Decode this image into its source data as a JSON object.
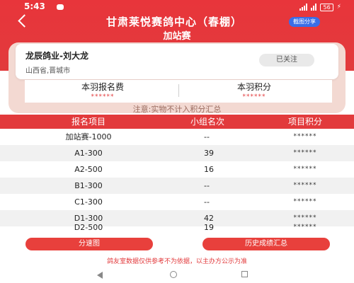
{
  "status_bar": {
    "time": "5:43",
    "battery": "56"
  },
  "header": {
    "title": "甘肃莱悦赛鸽中心（春棚）",
    "subtitle": "加站赛",
    "share_label": "截图分享"
  },
  "owner": {
    "name": "龙辰鸽业-刘大龙",
    "location": "山西省,晋城市",
    "follow_label": "已关注"
  },
  "stats": {
    "fee_label": "本羽报名费",
    "fee_value": "******",
    "score_label": "本羽积分",
    "score_value": "******"
  },
  "note": "注意:实物不计入积分汇总",
  "table": {
    "headers": [
      "报名项目",
      "小组名次",
      "项目积分"
    ],
    "rows": [
      {
        "item": "加站赛-1000",
        "rank": "--",
        "score": "******"
      },
      {
        "item": "A1-300",
        "rank": "39",
        "score": "******"
      },
      {
        "item": "A2-500",
        "rank": "16",
        "score": "******"
      },
      {
        "item": "B1-300",
        "rank": "--",
        "score": "******"
      },
      {
        "item": "C1-300",
        "rank": "--",
        "score": "******"
      },
      {
        "item": "D1-300",
        "rank": "42",
        "score": "******"
      },
      {
        "item": "D2-500",
        "rank": "19",
        "score": "******"
      }
    ]
  },
  "buttons": {
    "speed_chart": "分速图",
    "history": "历史成绩汇总"
  },
  "disclaimer": "鸽友室数据仅供参考不为依据，以主办方公示为准",
  "colors": {
    "primary": "#e23a3c",
    "share_button": "#3a6ee8"
  }
}
